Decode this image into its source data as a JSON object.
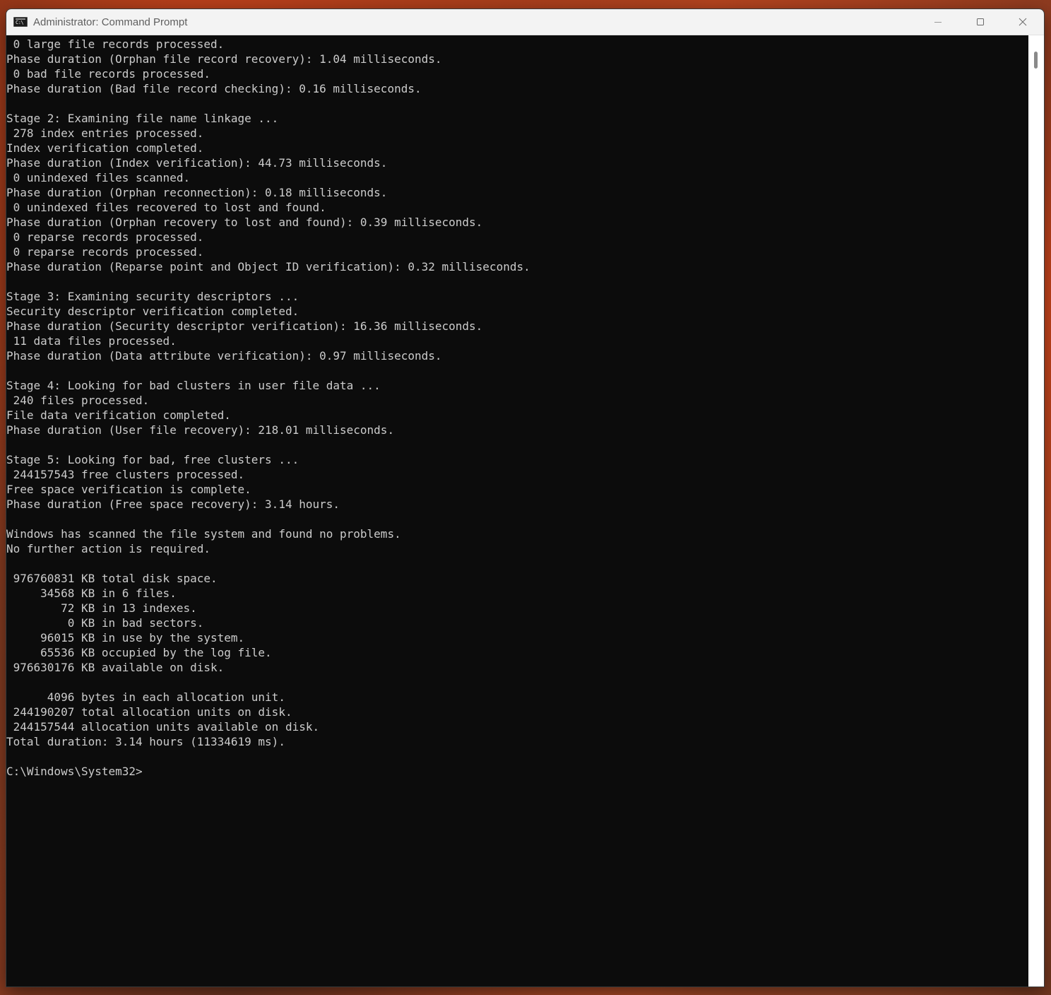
{
  "window": {
    "title": "Administrator: Command Prompt",
    "app_icon_text": "C:\\",
    "controls": {
      "minimize": "minimize-icon",
      "maximize": "maximize-icon",
      "close": "close-icon"
    }
  },
  "console": {
    "lines": [
      " 0 large file records processed.",
      "Phase duration (Orphan file record recovery): 1.04 milliseconds.",
      " 0 bad file records processed.",
      "Phase duration (Bad file record checking): 0.16 milliseconds.",
      "",
      "Stage 2: Examining file name linkage ...",
      " 278 index entries processed.",
      "Index verification completed.",
      "Phase duration (Index verification): 44.73 milliseconds.",
      " 0 unindexed files scanned.",
      "Phase duration (Orphan reconnection): 0.18 milliseconds.",
      " 0 unindexed files recovered to lost and found.",
      "Phase duration (Orphan recovery to lost and found): 0.39 milliseconds.",
      " 0 reparse records processed.",
      " 0 reparse records processed.",
      "Phase duration (Reparse point and Object ID verification): 0.32 milliseconds.",
      "",
      "Stage 3: Examining security descriptors ...",
      "Security descriptor verification completed.",
      "Phase duration (Security descriptor verification): 16.36 milliseconds.",
      " 11 data files processed.",
      "Phase duration (Data attribute verification): 0.97 milliseconds.",
      "",
      "Stage 4: Looking for bad clusters in user file data ...",
      " 240 files processed.",
      "File data verification completed.",
      "Phase duration (User file recovery): 218.01 milliseconds.",
      "",
      "Stage 5: Looking for bad, free clusters ...",
      " 244157543 free clusters processed.",
      "Free space verification is complete.",
      "Phase duration (Free space recovery): 3.14 hours.",
      "",
      "Windows has scanned the file system and found no problems.",
      "No further action is required.",
      "",
      " 976760831 KB total disk space.",
      "     34568 KB in 6 files.",
      "        72 KB in 13 indexes.",
      "         0 KB in bad sectors.",
      "     96015 KB in use by the system.",
      "     65536 KB occupied by the log file.",
      " 976630176 KB available on disk.",
      "",
      "      4096 bytes in each allocation unit.",
      " 244190207 total allocation units on disk.",
      " 244157544 allocation units available on disk.",
      "Total duration: 3.14 hours (11334619 ms).",
      "",
      "C:\\Windows\\System32>"
    ]
  }
}
